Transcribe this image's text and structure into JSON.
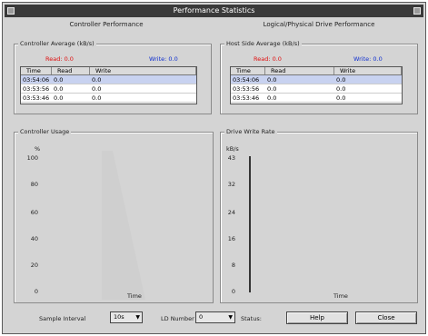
{
  "window": {
    "title": "Performance Statistics"
  },
  "left_panel": {
    "title": "Controller Performance",
    "stats": {
      "label": "Controller Average (kB/s)",
      "read": "Read: 0.0",
      "write": "Write: 0.0",
      "columns": [
        "Time",
        "Read",
        "Write"
      ],
      "rows": [
        [
          "03:54:06",
          "0.0",
          "0.0"
        ],
        [
          "03:53:56",
          "0.0",
          "0.0"
        ],
        [
          "03:53:46",
          "0.0",
          "0.0"
        ]
      ]
    },
    "graph": {
      "label": "Controller Usage",
      "y_unit": "%",
      "ticks": [
        "100",
        "80",
        "60",
        "40",
        "20",
        "0"
      ],
      "xlabel": "Time"
    }
  },
  "right_panel": {
    "title": "Logical/Physical Drive Performance",
    "stats": {
      "label": "Host Side Average (kB/s)",
      "read": "Read: 0.0",
      "write": "Write: 0.0",
      "columns": [
        "Time",
        "Read",
        "Write"
      ],
      "rows": [
        [
          "03:54:06",
          "0.0",
          "0.0"
        ],
        [
          "03:53:56",
          "0.0",
          "0.0"
        ],
        [
          "03:53:46",
          "0.0",
          "0.0"
        ]
      ]
    },
    "graph": {
      "label": "Drive Write Rate",
      "y_unit": "kB/s",
      "ticks": [
        "43",
        "32",
        "24",
        "16",
        "8",
        "0"
      ],
      "xlabel": "Time"
    }
  },
  "bottom": {
    "interval_label": "Sample Interval",
    "interval_value": "10s",
    "drive_label": "LD Number",
    "drive_value": "0",
    "status_label": "Status:",
    "help_button": "Help",
    "close_button": "Close"
  },
  "colors": {
    "read": "#e01010",
    "write": "#1030d0",
    "graph_fill": "#cfcfcf"
  }
}
